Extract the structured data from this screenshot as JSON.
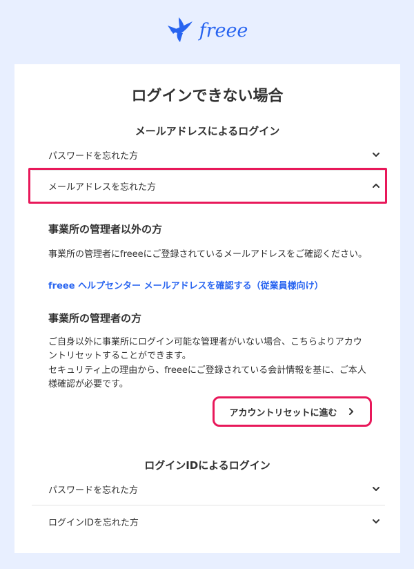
{
  "brand": {
    "logo_text": "freee",
    "accent_color": "#2864f0",
    "highlight_color": "#e8185a"
  },
  "page": {
    "title": "ログインできない場合"
  },
  "email_section": {
    "heading": "メールアドレスによるログイン",
    "items": [
      {
        "label": "パスワードを忘れた方",
        "icon": "chevron-down-icon",
        "expanded": false
      },
      {
        "label": "メールアドレスを忘れた方",
        "icon": "chevron-up-icon",
        "expanded": true
      }
    ]
  },
  "expanded_panel": {
    "non_admin": {
      "heading": "事業所の管理者以外の方",
      "text": "事業所の管理者にfreeeにご登録されているメールアドレスをご確認ください。",
      "link_label": "freee ヘルプセンター メールアドレスを確認する（従業員様向け）"
    },
    "admin": {
      "heading": "事業所の管理者の方",
      "text": "ご自身以外に事業所にログイン可能な管理者がいない場合、こちらよりアカウントリセットすることができます。",
      "text2": "セキュリティ上の理由から、freeeにご登録されている会計情報を基に、ご本人様確認が必要です。",
      "button_label": "アカウントリセットに進む",
      "button_icon": "chevron-right-icon"
    }
  },
  "login_id_section": {
    "heading": "ログインIDによるログイン",
    "items": [
      {
        "label": "パスワードを忘れた方",
        "icon": "chevron-down-icon",
        "expanded": false
      },
      {
        "label": "ログインIDを忘れた方",
        "icon": "chevron-down-icon",
        "expanded": false
      }
    ]
  }
}
